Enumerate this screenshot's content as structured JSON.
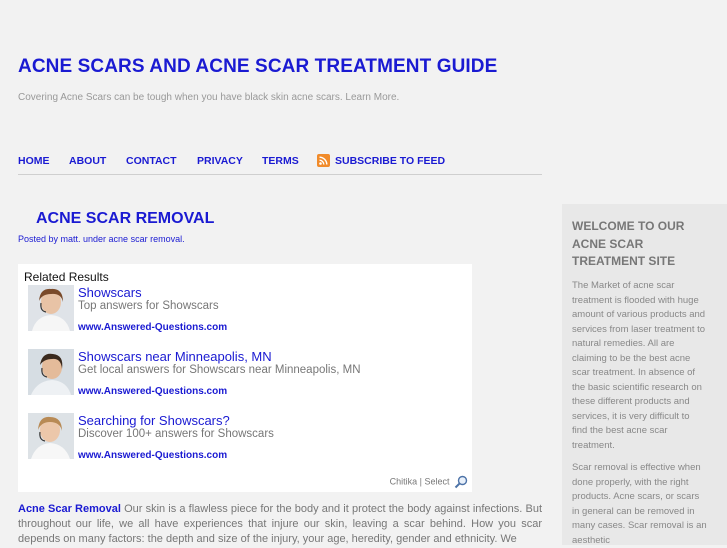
{
  "header": {
    "title": "ACNE SCARS AND ACNE SCAR TREATMENT GUIDE",
    "tagline": "Covering Acne Scars can be tough when you have black skin acne scars. Learn More."
  },
  "nav": {
    "items": [
      "HOME",
      "ABOUT",
      "CONTACT",
      "PRIVACY",
      "TERMS"
    ],
    "subscribe": "SUBSCRIBE TO FEED",
    "rss_icon": "rss-feed-icon",
    "rss_color": "#f18b2a"
  },
  "post": {
    "title": "ACNE SCAR REMOVAL",
    "meta": "Posted by matt. under acne scar removal."
  },
  "ads": {
    "heading": "Related Results",
    "items": [
      {
        "title": "Showscars",
        "desc": "Top answers for Showscars",
        "url": "www.Answered-Questions.com"
      },
      {
        "title": "Showscars near Minneapolis, MN",
        "desc": "Get local answers for Showscars near Minneapolis, MN",
        "url": "www.Answered-Questions.com"
      },
      {
        "title": "Searching for Showscars?",
        "desc": "Discover 100+ answers for Showscars",
        "url": "www.Answered-Questions.com"
      }
    ],
    "footer": "Chitika | Select"
  },
  "content": {
    "lead": "Acne Scar Removal",
    "text": " Our skin is a flawless piece for the body and it protect the body against infections. But throughout our life, we all have experiences that injure our skin, leaving a scar behind. How you scar depends on many factors: the depth and size of the injury, your age, heredity, gender and ethnicity. We"
  },
  "sidebar": {
    "title": "WELCOME TO OUR ACNE SCAR TREATMENT SITE",
    "para1": "The Market of acne scar treatment is flooded with huge amount of various products and services from laser treatment to natural remedies. All are claiming to be the best acne scar treatment. In absence of the basic scientific research on these different products and services, it is very difficult to find the best acne scar treatment.",
    "para2": "Scar removal is effective when done properly, with the right products. Acne scars, or scars in general can be removed in many cases. Scar removal is an aesthetic"
  },
  "colors": {
    "link": "#1a1ad2",
    "background": "#f2f2f2",
    "sidebar": "#e8e8e8"
  }
}
